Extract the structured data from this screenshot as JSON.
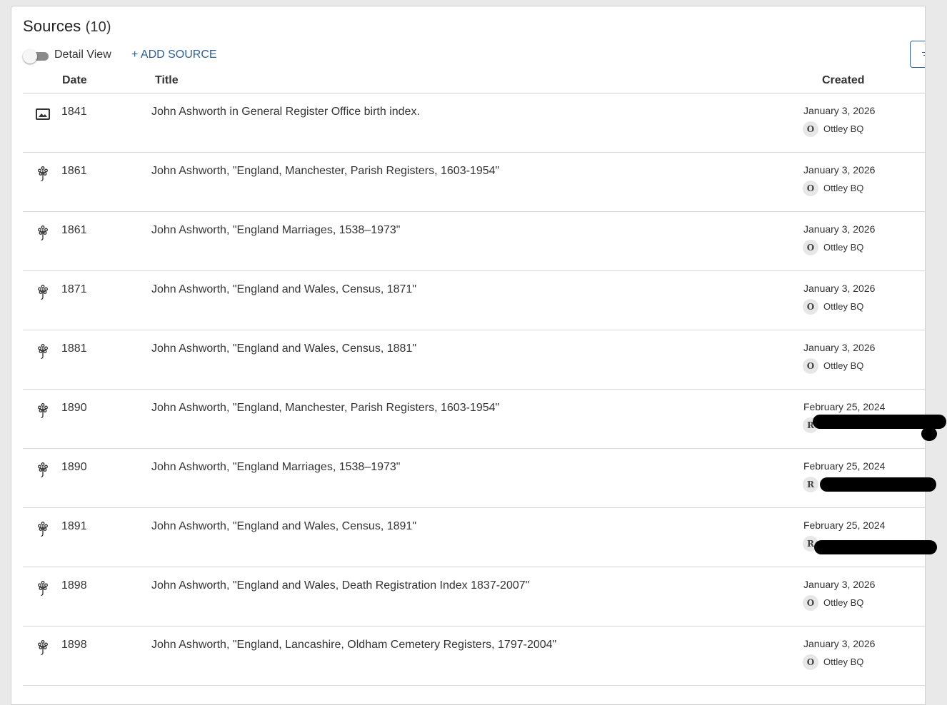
{
  "header": {
    "title": "Sources",
    "count": "(10)"
  },
  "toolbar": {
    "detail_view_label": "Detail View",
    "add_source_label": "+ ADD SOURCE"
  },
  "columns": {
    "date": "Date",
    "title": "Title",
    "created": "Created"
  },
  "rows": [
    {
      "icon": "image-icon",
      "date": "1841",
      "title": "John Ashworth in General Register Office birth index.",
      "created": "January 3, 2026",
      "avatar": "O",
      "user": "Ottley BQ"
    },
    {
      "icon": "tree-icon",
      "date": "1861",
      "title": "John Ashworth, \"England, Manchester, Parish Registers, 1603-1954\"",
      "created": "January 3, 2026",
      "avatar": "O",
      "user": "Ottley BQ"
    },
    {
      "icon": "tree-icon",
      "date": "1861",
      "title": "John Ashworth, \"England Marriages, 1538–1973\"",
      "created": "January 3, 2026",
      "avatar": "O",
      "user": "Ottley BQ"
    },
    {
      "icon": "tree-icon",
      "date": "1871",
      "title": "John Ashworth, \"England and Wales, Census, 1871\"",
      "created": "January 3, 2026",
      "avatar": "O",
      "user": "Ottley BQ"
    },
    {
      "icon": "tree-icon",
      "date": "1881",
      "title": "John Ashworth, \"England and Wales, Census, 1881\"",
      "created": "January 3, 2026",
      "avatar": "O",
      "user": "Ottley BQ"
    },
    {
      "icon": "tree-icon",
      "date": "1890",
      "title": "John Ashworth, \"England, Manchester, Parish Registers, 1603-1954\"",
      "created": "February 25, 2024",
      "avatar": "R",
      "user": ""
    },
    {
      "icon": "tree-icon",
      "date": "1890",
      "title": "John Ashworth, \"England Marriages, 1538–1973\"",
      "created": "February 25, 2024",
      "avatar": "R",
      "user": ""
    },
    {
      "icon": "tree-icon",
      "date": "1891",
      "title": "John Ashworth, \"England and Wales, Census, 1891\"",
      "created": "February 25, 2024",
      "avatar": "R",
      "user": ""
    },
    {
      "icon": "tree-icon",
      "date": "1898",
      "title": "John Ashworth, \"England and Wales, Death Registration Index 1837-2007\"",
      "created": "January 3, 2026",
      "avatar": "O",
      "user": "Ottley BQ"
    },
    {
      "icon": "tree-icon",
      "date": "1898",
      "title": "John Ashworth, \"England, Lancashire, Oldham Cemetery Registers, 1797-2004\"",
      "created": "January 3, 2026",
      "avatar": "O",
      "user": "Ottley BQ"
    }
  ],
  "colors": {
    "accent": "#2d5f97",
    "text": "#333333",
    "divider": "#d6d6d6"
  }
}
